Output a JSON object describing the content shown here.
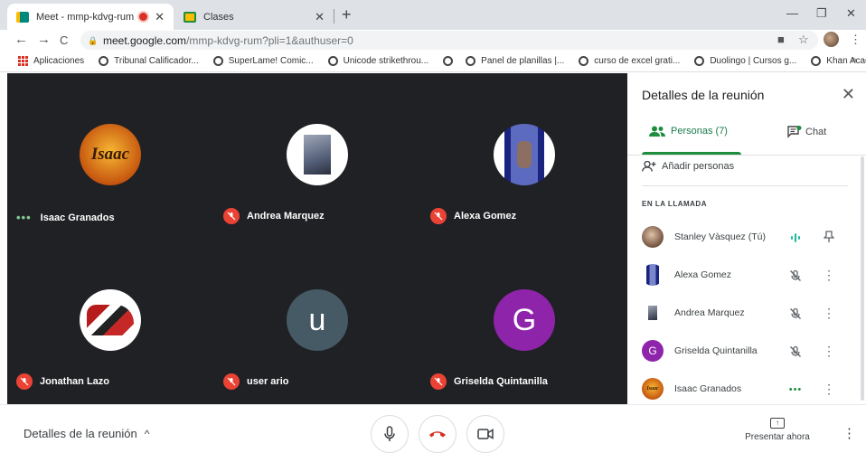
{
  "browser": {
    "tabs": [
      {
        "title": "Meet - mmp-kdvg-rum",
        "active": true,
        "recording": true
      },
      {
        "title": "Clases",
        "active": false
      }
    ],
    "new_tab": "+",
    "window_controls": {
      "minimize": "—",
      "restore": "❐",
      "close": "✕"
    },
    "nav": {
      "back": "←",
      "forward": "→",
      "reload": "C"
    },
    "url_host": "meet.google.com",
    "url_path": "/mmp-kdvg-rum?pli=1&authuser=0",
    "bookmarks": [
      "Aplicaciones",
      "Tribunal Calificador...",
      "SuperLame! Comic...",
      "Unicode strikethrou...",
      "",
      "Panel de planillas |...",
      "curso de excel grati...",
      "Duolingo | Cursos g...",
      "Khan Academy"
    ],
    "bookmarks_more": "»"
  },
  "tiles": [
    {
      "name": "Isaac Granados",
      "status": "speaking",
      "avatar_kind": "isaac",
      "avatar_text": "Isaac"
    },
    {
      "name": "Andrea Marquez",
      "status": "muted",
      "avatar_kind": "photo-andrea"
    },
    {
      "name": "Alexa Gomez",
      "status": "muted",
      "avatar_kind": "photo-alexa"
    },
    {
      "name": "Jonathan Lazo",
      "status": "muted",
      "avatar_kind": "photo-jonathan"
    },
    {
      "name": "user ario",
      "status": "muted",
      "avatar_kind": "letter",
      "avatar_text": "u",
      "avatar_color": "#455a64"
    },
    {
      "name": "Griselda Quintanilla",
      "status": "muted",
      "avatar_kind": "letter",
      "avatar_text": "G",
      "avatar_color": "#8e24aa"
    }
  ],
  "panel": {
    "title": "Detalles de la reunión",
    "close": "✕",
    "people_tab": "Personas (7)",
    "chat_tab": "Chat",
    "add_people": "Añadir personas",
    "section_label": "EN LA LLAMADA",
    "participants": [
      {
        "name": "Stanley Vàsquez (Tú)",
        "status": "speaking",
        "action": "pin"
      },
      {
        "name": "Alexa Gomez",
        "status": "muted",
        "action": "more"
      },
      {
        "name": "Andrea Marquez",
        "status": "muted",
        "action": "more"
      },
      {
        "name": "Griselda Quintanilla",
        "status": "muted",
        "action": "more",
        "avatar_text": "G"
      },
      {
        "name": "Isaac Granados",
        "status": "dots",
        "action": "more",
        "avatar_text": "Isaac"
      }
    ]
  },
  "bottom": {
    "meeting_details": "Detalles de la reunión",
    "present_label": "Presentar ahora"
  },
  "colors": {
    "stage_bg": "#202124",
    "accent_green": "#1e8e3e",
    "mute_red": "#ea4335",
    "hangup_red": "#d93025"
  }
}
